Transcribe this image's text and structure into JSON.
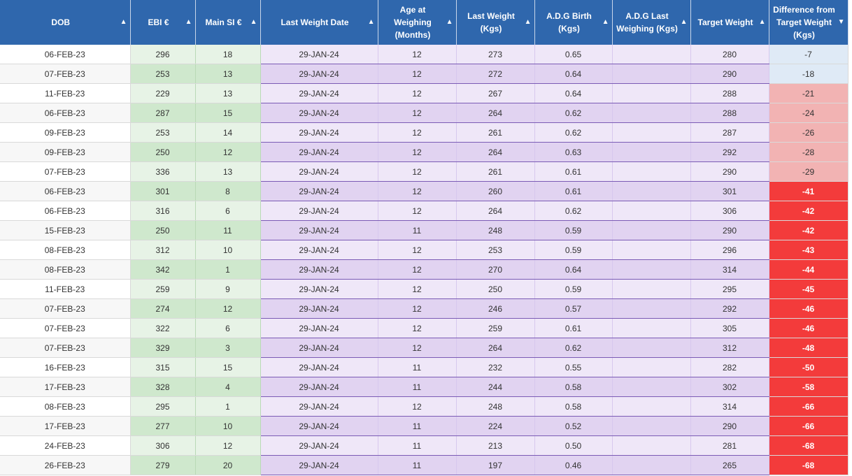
{
  "columns": [
    {
      "key": "dob",
      "label": "DOB",
      "sort": "▲"
    },
    {
      "key": "ebi",
      "label": "EBI €",
      "sort": "▲"
    },
    {
      "key": "si",
      "label": "Main SI €",
      "sort": "▲"
    },
    {
      "key": "date",
      "label": "Last Weight Date",
      "sort": "▲"
    },
    {
      "key": "age",
      "label": "Age at Weighing (Months)",
      "sort": "▲"
    },
    {
      "key": "lw",
      "label": "Last Weight (Kgs)",
      "sort": "▲"
    },
    {
      "key": "adgb",
      "label": "A.D.G Birth (Kgs)",
      "sort": "▲"
    },
    {
      "key": "adgl",
      "label": "A.D.G Last Weighing (Kgs)",
      "sort": "▲"
    },
    {
      "key": "tw",
      "label": "Target Weight",
      "sort": "▲"
    },
    {
      "key": "diff",
      "label": "Difference from Target Weight (Kgs)",
      "sort": "▼"
    }
  ],
  "colors": {
    "header": "#2f67ad",
    "green_light": "#e7f3e6",
    "green_dark": "#cfe8cd",
    "purple_light": "#efe7f8",
    "purple_dark": "#e1d3f1",
    "diff_light": "#dfeaf6",
    "diff_pink": "#f2b3b3",
    "diff_red": "#f33b3b"
  },
  "rows": [
    {
      "dob": "06-FEB-23",
      "ebi": "296",
      "si": "18",
      "date": "29-JAN-24",
      "age": "12",
      "lw": "273",
      "adgb": "0.65",
      "adgl": "",
      "tw": "280",
      "diff": "-7",
      "level": "light"
    },
    {
      "dob": "07-FEB-23",
      "ebi": "253",
      "si": "13",
      "date": "29-JAN-24",
      "age": "12",
      "lw": "272",
      "adgb": "0.64",
      "adgl": "",
      "tw": "290",
      "diff": "-18",
      "level": "light"
    },
    {
      "dob": "11-FEB-23",
      "ebi": "229",
      "si": "13",
      "date": "29-JAN-24",
      "age": "12",
      "lw": "267",
      "adgb": "0.64",
      "adgl": "",
      "tw": "288",
      "diff": "-21",
      "level": "pink"
    },
    {
      "dob": "06-FEB-23",
      "ebi": "287",
      "si": "15",
      "date": "29-JAN-24",
      "age": "12",
      "lw": "264",
      "adgb": "0.62",
      "adgl": "",
      "tw": "288",
      "diff": "-24",
      "level": "pink"
    },
    {
      "dob": "09-FEB-23",
      "ebi": "253",
      "si": "14",
      "date": "29-JAN-24",
      "age": "12",
      "lw": "261",
      "adgb": "0.62",
      "adgl": "",
      "tw": "287",
      "diff": "-26",
      "level": "pink"
    },
    {
      "dob": "09-FEB-23",
      "ebi": "250",
      "si": "12",
      "date": "29-JAN-24",
      "age": "12",
      "lw": "264",
      "adgb": "0.63",
      "adgl": "",
      "tw": "292",
      "diff": "-28",
      "level": "pink"
    },
    {
      "dob": "07-FEB-23",
      "ebi": "336",
      "si": "13",
      "date": "29-JAN-24",
      "age": "12",
      "lw": "261",
      "adgb": "0.61",
      "adgl": "",
      "tw": "290",
      "diff": "-29",
      "level": "pink"
    },
    {
      "dob": "06-FEB-23",
      "ebi": "301",
      "si": "8",
      "date": "29-JAN-24",
      "age": "12",
      "lw": "260",
      "adgb": "0.61",
      "adgl": "",
      "tw": "301",
      "diff": "-41",
      "level": "red"
    },
    {
      "dob": "06-FEB-23",
      "ebi": "316",
      "si": "6",
      "date": "29-JAN-24",
      "age": "12",
      "lw": "264",
      "adgb": "0.62",
      "adgl": "",
      "tw": "306",
      "diff": "-42",
      "level": "red"
    },
    {
      "dob": "15-FEB-23",
      "ebi": "250",
      "si": "11",
      "date": "29-JAN-24",
      "age": "11",
      "lw": "248",
      "adgb": "0.59",
      "adgl": "",
      "tw": "290",
      "diff": "-42",
      "level": "red"
    },
    {
      "dob": "08-FEB-23",
      "ebi": "312",
      "si": "10",
      "date": "29-JAN-24",
      "age": "12",
      "lw": "253",
      "adgb": "0.59",
      "adgl": "",
      "tw": "296",
      "diff": "-43",
      "level": "red"
    },
    {
      "dob": "08-FEB-23",
      "ebi": "342",
      "si": "1",
      "date": "29-JAN-24",
      "age": "12",
      "lw": "270",
      "adgb": "0.64",
      "adgl": "",
      "tw": "314",
      "diff": "-44",
      "level": "red"
    },
    {
      "dob": "11-FEB-23",
      "ebi": "259",
      "si": "9",
      "date": "29-JAN-24",
      "age": "12",
      "lw": "250",
      "adgb": "0.59",
      "adgl": "",
      "tw": "295",
      "diff": "-45",
      "level": "red"
    },
    {
      "dob": "07-FEB-23",
      "ebi": "274",
      "si": "12",
      "date": "29-JAN-24",
      "age": "12",
      "lw": "246",
      "adgb": "0.57",
      "adgl": "",
      "tw": "292",
      "diff": "-46",
      "level": "red"
    },
    {
      "dob": "07-FEB-23",
      "ebi": "322",
      "si": "6",
      "date": "29-JAN-24",
      "age": "12",
      "lw": "259",
      "adgb": "0.61",
      "adgl": "",
      "tw": "305",
      "diff": "-46",
      "level": "red"
    },
    {
      "dob": "07-FEB-23",
      "ebi": "329",
      "si": "3",
      "date": "29-JAN-24",
      "age": "12",
      "lw": "264",
      "adgb": "0.62",
      "adgl": "",
      "tw": "312",
      "diff": "-48",
      "level": "red"
    },
    {
      "dob": "16-FEB-23",
      "ebi": "315",
      "si": "15",
      "date": "29-JAN-24",
      "age": "11",
      "lw": "232",
      "adgb": "0.55",
      "adgl": "",
      "tw": "282",
      "diff": "-50",
      "level": "red"
    },
    {
      "dob": "17-FEB-23",
      "ebi": "328",
      "si": "4",
      "date": "29-JAN-24",
      "age": "11",
      "lw": "244",
      "adgb": "0.58",
      "adgl": "",
      "tw": "302",
      "diff": "-58",
      "level": "red"
    },
    {
      "dob": "08-FEB-23",
      "ebi": "295",
      "si": "1",
      "date": "29-JAN-24",
      "age": "12",
      "lw": "248",
      "adgb": "0.58",
      "adgl": "",
      "tw": "314",
      "diff": "-66",
      "level": "red"
    },
    {
      "dob": "17-FEB-23",
      "ebi": "277",
      "si": "10",
      "date": "29-JAN-24",
      "age": "11",
      "lw": "224",
      "adgb": "0.52",
      "adgl": "",
      "tw": "290",
      "diff": "-66",
      "level": "red"
    },
    {
      "dob": "24-FEB-23",
      "ebi": "306",
      "si": "12",
      "date": "29-JAN-24",
      "age": "11",
      "lw": "213",
      "adgb": "0.50",
      "adgl": "",
      "tw": "281",
      "diff": "-68",
      "level": "red"
    },
    {
      "dob": "26-FEB-23",
      "ebi": "279",
      "si": "20",
      "date": "29-JAN-24",
      "age": "11",
      "lw": "197",
      "adgb": "0.46",
      "adgl": "",
      "tw": "265",
      "diff": "-68",
      "level": "red"
    }
  ]
}
